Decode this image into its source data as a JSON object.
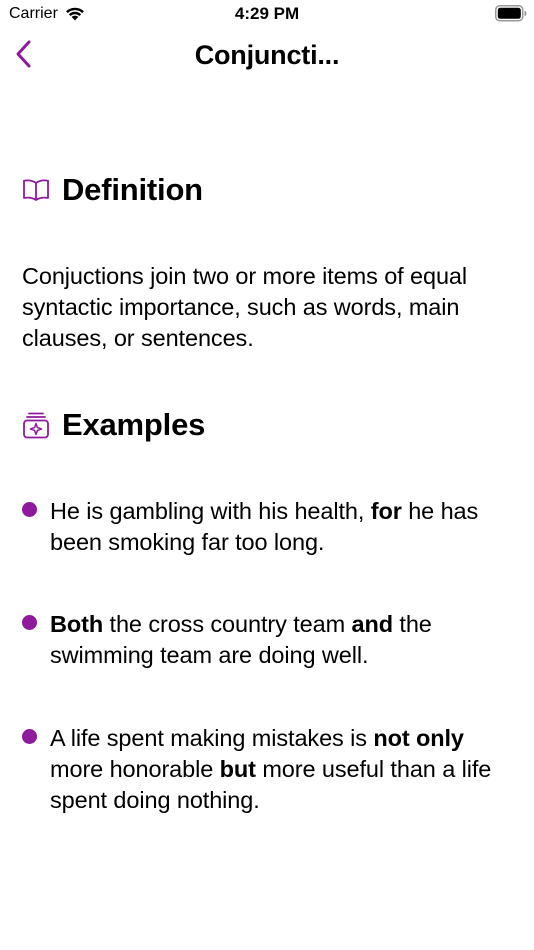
{
  "status_bar": {
    "carrier": "Carrier",
    "time": "4:29 PM"
  },
  "nav": {
    "title": "Conjuncti...",
    "back_icon": "chevron-left-icon",
    "accent_color": "#8e1a9c"
  },
  "definition": {
    "icon": "book-icon",
    "title": "Definition",
    "text": "Conjuctions join two or more items of equal syntactic importance, such as words, main clauses, or sentences."
  },
  "examples": {
    "icon": "sparkle-box-icon",
    "title": "Examples",
    "items": [
      {
        "segments": [
          {
            "text": "He is gambling with his health, ",
            "bold": false
          },
          {
            "text": "for",
            "bold": true
          },
          {
            "text": " he has been smoking far too long.",
            "bold": false
          }
        ]
      },
      {
        "segments": [
          {
            "text": "Both",
            "bold": true
          },
          {
            "text": " the cross country team ",
            "bold": false
          },
          {
            "text": "and",
            "bold": true
          },
          {
            "text": " the swimming team are doing well.",
            "bold": false
          }
        ]
      },
      {
        "segments": [
          {
            "text": "A life spent making mistakes is ",
            "bold": false
          },
          {
            "text": "not only",
            "bold": true
          },
          {
            "text": " more honorable ",
            "bold": false
          },
          {
            "text": "but",
            "bold": true
          },
          {
            "text": " more useful than a life spent doing nothing.",
            "bold": false
          }
        ]
      }
    ]
  }
}
